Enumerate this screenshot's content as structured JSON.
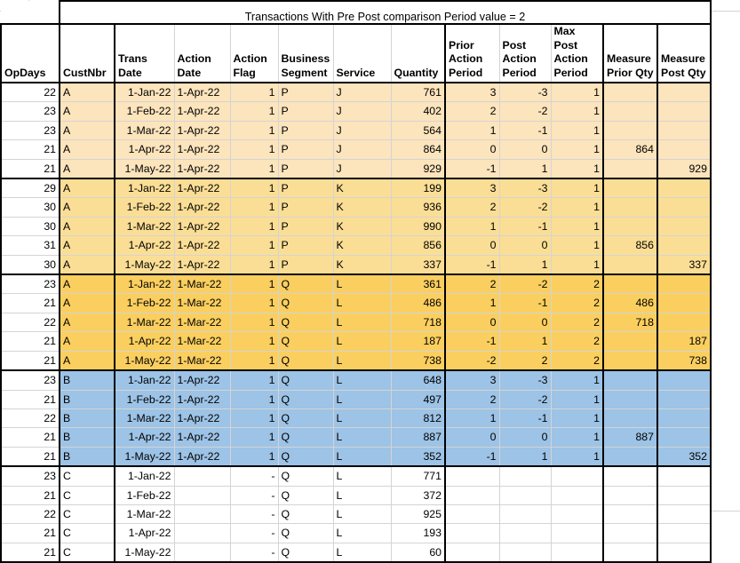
{
  "title": "Transactions With Pre Post comparison Period value = 2",
  "columns": [
    {
      "key": "opdays",
      "label": "OpDays",
      "align": "right"
    },
    {
      "key": "custnbr",
      "label": "CustNbr",
      "align": "left"
    },
    {
      "key": "trans_date",
      "label": "Trans Date",
      "align": "right"
    },
    {
      "key": "action_date",
      "label": "Action Date",
      "align": "left"
    },
    {
      "key": "action_flag",
      "label": "Action Flag",
      "align": "right"
    },
    {
      "key": "business_segment",
      "label": "Business Segment",
      "align": "left"
    },
    {
      "key": "service",
      "label": "Service",
      "align": "left"
    },
    {
      "key": "quantity",
      "label": "Quantity",
      "align": "right"
    },
    {
      "key": "prior_action",
      "label": "Prior Action Period",
      "align": "right"
    },
    {
      "key": "post_action",
      "label": "Post Action Period",
      "align": "right"
    },
    {
      "key": "max_post_action",
      "label": "Max Post Action Period",
      "align": "right"
    },
    {
      "key": "measure_prior",
      "label": "Measure Prior Qty",
      "align": "right"
    },
    {
      "key": "measure_post",
      "label": "Measure Post Qty",
      "align": "right"
    }
  ],
  "header_lines": [
    [
      "",
      "",
      "",
      "",
      "",
      "",
      "",
      "",
      "",
      "",
      "",
      "",
      ""
    ],
    [
      "",
      "",
      "Trans",
      "Action",
      "Action",
      "Business",
      "",
      "",
      "Prior",
      "Post",
      "Max Post",
      "",
      ""
    ],
    [
      "",
      "",
      "",
      "",
      "",
      "",
      "",
      "",
      "Action",
      "Action",
      "Action",
      "Measure",
      "Measure"
    ],
    [
      "OpDays",
      "CustNbr",
      "Date",
      "Date",
      "Flag",
      "Segment",
      "Service",
      "Quantity",
      "Period",
      "Period",
      "Period",
      "Prior Qty",
      "Post Qty"
    ]
  ],
  "colors": {
    "group_cream": "#FCE4BC",
    "group_lightgold": "#FBDE95",
    "group_gold": "#FACF5F",
    "group_blue": "#9DC3E6",
    "group_white": "#FFFFFF",
    "grid_line": "#D4D4D4",
    "outline": "#000000",
    "text": "#000000"
  },
  "groups": [
    {
      "name": "group-a-j",
      "fill": "#FCE4BC",
      "rows": [
        {
          "opdays": "22",
          "custnbr": "A",
          "trans_date": "1-Jan-22",
          "action_date": "1-Apr-22",
          "action_flag": "1",
          "business_segment": "P",
          "service": "J",
          "quantity": "761",
          "prior_action": "3",
          "post_action": "-3",
          "max_post_action": "1",
          "measure_prior": "",
          "measure_post": "",
          "bold": false
        },
        {
          "opdays": "23",
          "custnbr": "A",
          "trans_date": "1-Feb-22",
          "action_date": "1-Apr-22",
          "action_flag": "1",
          "business_segment": "P",
          "service": "J",
          "quantity": "402",
          "prior_action": "2",
          "post_action": "-2",
          "max_post_action": "1",
          "measure_prior": "",
          "measure_post": "",
          "bold": false
        },
        {
          "opdays": "23",
          "custnbr": "A",
          "trans_date": "1-Mar-22",
          "action_date": "1-Apr-22",
          "action_flag": "1",
          "business_segment": "P",
          "service": "J",
          "quantity": "564",
          "prior_action": "1",
          "post_action": "-1",
          "max_post_action": "1",
          "measure_prior": "",
          "measure_post": "",
          "bold": false
        },
        {
          "opdays": "21",
          "custnbr": "A",
          "trans_date": "1-Apr-22",
          "action_date": "1-Apr-22",
          "action_flag": "1",
          "business_segment": "P",
          "service": "J",
          "quantity": "864",
          "prior_action": "0",
          "post_action": "0",
          "max_post_action": "1",
          "measure_prior": "864",
          "measure_post": "",
          "bold": true
        },
        {
          "opdays": "21",
          "custnbr": "A",
          "trans_date": "1-May-22",
          "action_date": "1-Apr-22",
          "action_flag": "1",
          "business_segment": "P",
          "service": "J",
          "quantity": "929",
          "prior_action": "-1",
          "post_action": "1",
          "max_post_action": "1",
          "measure_prior": "",
          "measure_post": "929",
          "bold": true
        }
      ]
    },
    {
      "name": "group-a-k",
      "fill": "#FBDE95",
      "rows": [
        {
          "opdays": "29",
          "custnbr": "A",
          "trans_date": "1-Jan-22",
          "action_date": "1-Apr-22",
          "action_flag": "1",
          "business_segment": "P",
          "service": "K",
          "quantity": "199",
          "prior_action": "3",
          "post_action": "-3",
          "max_post_action": "1",
          "measure_prior": "",
          "measure_post": "",
          "bold": false
        },
        {
          "opdays": "30",
          "custnbr": "A",
          "trans_date": "1-Feb-22",
          "action_date": "1-Apr-22",
          "action_flag": "1",
          "business_segment": "P",
          "service": "K",
          "quantity": "936",
          "prior_action": "2",
          "post_action": "-2",
          "max_post_action": "1",
          "measure_prior": "",
          "measure_post": "",
          "bold": false
        },
        {
          "opdays": "30",
          "custnbr": "A",
          "trans_date": "1-Mar-22",
          "action_date": "1-Apr-22",
          "action_flag": "1",
          "business_segment": "P",
          "service": "K",
          "quantity": "990",
          "prior_action": "1",
          "post_action": "-1",
          "max_post_action": "1",
          "measure_prior": "",
          "measure_post": "",
          "bold": false
        },
        {
          "opdays": "31",
          "custnbr": "A",
          "trans_date": "1-Apr-22",
          "action_date": "1-Apr-22",
          "action_flag": "1",
          "business_segment": "P",
          "service": "K",
          "quantity": "856",
          "prior_action": "0",
          "post_action": "0",
          "max_post_action": "1",
          "measure_prior": "856",
          "measure_post": "",
          "bold": true
        },
        {
          "opdays": "30",
          "custnbr": "A",
          "trans_date": "1-May-22",
          "action_date": "1-Apr-22",
          "action_flag": "1",
          "business_segment": "P",
          "service": "K",
          "quantity": "337",
          "prior_action": "-1",
          "post_action": "1",
          "max_post_action": "1",
          "measure_prior": "",
          "measure_post": "337",
          "bold": true
        }
      ]
    },
    {
      "name": "group-a-l",
      "fill": "#FACF5F",
      "rows": [
        {
          "opdays": "23",
          "custnbr": "A",
          "trans_date": "1-Jan-22",
          "action_date": "1-Mar-22",
          "action_flag": "1",
          "business_segment": "Q",
          "service": "L",
          "quantity": "361",
          "prior_action": "2",
          "post_action": "-2",
          "max_post_action": "2",
          "measure_prior": "",
          "measure_post": "",
          "bold": false
        },
        {
          "opdays": "21",
          "custnbr": "A",
          "trans_date": "1-Feb-22",
          "action_date": "1-Mar-22",
          "action_flag": "1",
          "business_segment": "Q",
          "service": "L",
          "quantity": "486",
          "prior_action": "1",
          "post_action": "-1",
          "max_post_action": "2",
          "measure_prior": "486",
          "measure_post": "",
          "bold": true
        },
        {
          "opdays": "22",
          "custnbr": "A",
          "trans_date": "1-Mar-22",
          "action_date": "1-Mar-22",
          "action_flag": "1",
          "business_segment": "Q",
          "service": "L",
          "quantity": "718",
          "prior_action": "0",
          "post_action": "0",
          "max_post_action": "2",
          "measure_prior": "718",
          "measure_post": "",
          "bold": true
        },
        {
          "opdays": "21",
          "custnbr": "A",
          "trans_date": "1-Apr-22",
          "action_date": "1-Mar-22",
          "action_flag": "1",
          "business_segment": "Q",
          "service": "L",
          "quantity": "187",
          "prior_action": "-1",
          "post_action": "1",
          "max_post_action": "2",
          "measure_prior": "",
          "measure_post": "187",
          "bold": true
        },
        {
          "opdays": "21",
          "custnbr": "A",
          "trans_date": "1-May-22",
          "action_date": "1-Mar-22",
          "action_flag": "1",
          "business_segment": "Q",
          "service": "L",
          "quantity": "738",
          "prior_action": "-2",
          "post_action": "2",
          "max_post_action": "2",
          "measure_prior": "",
          "measure_post": "738",
          "bold": true
        }
      ]
    },
    {
      "name": "group-b-l",
      "fill": "#9DC3E6",
      "rows": [
        {
          "opdays": "23",
          "custnbr": "B",
          "trans_date": "1-Jan-22",
          "action_date": "1-Apr-22",
          "action_flag": "1",
          "business_segment": "Q",
          "service": "L",
          "quantity": "648",
          "prior_action": "3",
          "post_action": "-3",
          "max_post_action": "1",
          "measure_prior": "",
          "measure_post": "",
          "bold": false
        },
        {
          "opdays": "21",
          "custnbr": "B",
          "trans_date": "1-Feb-22",
          "action_date": "1-Apr-22",
          "action_flag": "1",
          "business_segment": "Q",
          "service": "L",
          "quantity": "497",
          "prior_action": "2",
          "post_action": "-2",
          "max_post_action": "1",
          "measure_prior": "",
          "measure_post": "",
          "bold": false
        },
        {
          "opdays": "22",
          "custnbr": "B",
          "trans_date": "1-Mar-22",
          "action_date": "1-Apr-22",
          "action_flag": "1",
          "business_segment": "Q",
          "service": "L",
          "quantity": "812",
          "prior_action": "1",
          "post_action": "-1",
          "max_post_action": "1",
          "measure_prior": "",
          "measure_post": "",
          "bold": false
        },
        {
          "opdays": "21",
          "custnbr": "B",
          "trans_date": "1-Apr-22",
          "action_date": "1-Apr-22",
          "action_flag": "1",
          "business_segment": "Q",
          "service": "L",
          "quantity": "887",
          "prior_action": "0",
          "post_action": "0",
          "max_post_action": "1",
          "measure_prior": "887",
          "measure_post": "",
          "bold": true
        },
        {
          "opdays": "21",
          "custnbr": "B",
          "trans_date": "1-May-22",
          "action_date": "1-Apr-22",
          "action_flag": "1",
          "business_segment": "Q",
          "service": "L",
          "quantity": "352",
          "prior_action": "-1",
          "post_action": "1",
          "max_post_action": "1",
          "measure_prior": "",
          "measure_post": "352",
          "bold": true
        }
      ]
    },
    {
      "name": "group-c-l",
      "fill": "#FFFFFF",
      "rows": [
        {
          "opdays": "23",
          "custnbr": "C",
          "trans_date": "1-Jan-22",
          "action_date": "",
          "action_flag": "-",
          "business_segment": "Q",
          "service": "L",
          "quantity": "771",
          "prior_action": "",
          "post_action": "",
          "max_post_action": "",
          "measure_prior": "",
          "measure_post": "",
          "bold": false
        },
        {
          "opdays": "21",
          "custnbr": "C",
          "trans_date": "1-Feb-22",
          "action_date": "",
          "action_flag": "-",
          "business_segment": "Q",
          "service": "L",
          "quantity": "372",
          "prior_action": "",
          "post_action": "",
          "max_post_action": "",
          "measure_prior": "",
          "measure_post": "",
          "bold": false
        },
        {
          "opdays": "22",
          "custnbr": "C",
          "trans_date": "1-Mar-22",
          "action_date": "",
          "action_flag": "-",
          "business_segment": "Q",
          "service": "L",
          "quantity": "925",
          "prior_action": "",
          "post_action": "",
          "max_post_action": "",
          "measure_prior": "",
          "measure_post": "",
          "bold": false
        },
        {
          "opdays": "21",
          "custnbr": "C",
          "trans_date": "1-Apr-22",
          "action_date": "",
          "action_flag": "-",
          "business_segment": "Q",
          "service": "L",
          "quantity": "193",
          "prior_action": "",
          "post_action": "",
          "max_post_action": "",
          "measure_prior": "",
          "measure_post": "",
          "bold": false
        },
        {
          "opdays": "21",
          "custnbr": "C",
          "trans_date": "1-May-22",
          "action_date": "",
          "action_flag": "-",
          "business_segment": "Q",
          "service": "L",
          "quantity": "60",
          "prior_action": "",
          "post_action": "",
          "max_post_action": "",
          "measure_prior": "",
          "measure_post": "",
          "bold": false
        }
      ]
    }
  ]
}
